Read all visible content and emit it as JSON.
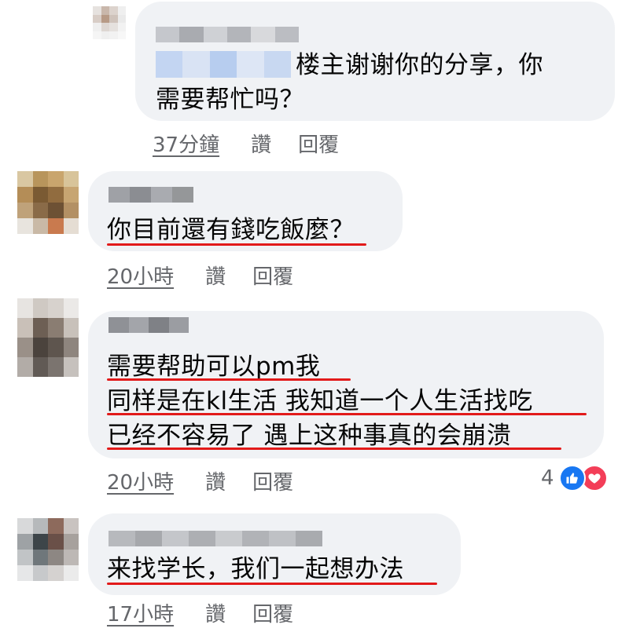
{
  "colors": {
    "bubble": "#f0f2f5",
    "meta_text": "#65676b",
    "underline": "#e21a1a",
    "like_blue": "#1877f2",
    "love_red": "#f33e58"
  },
  "comments": [
    {
      "text_lines": [
        "楼主谢谢你的分享，你",
        "需要帮忙吗？"
      ],
      "time": "37分鐘",
      "like": "讚",
      "reply": "回覆"
    },
    {
      "text_lines": [
        "你目前還有錢吃飯麼？"
      ],
      "time": "20小時",
      "like": "讚",
      "reply": "回覆"
    },
    {
      "text_lines": [
        "需要帮助可以pm我",
        "同样是在kl生活 我知道一个人生活找吃",
        "已经不容易了 遇上这种事真的会崩溃"
      ],
      "time": "20小時",
      "like": "讚",
      "reply": "回覆",
      "reaction_count": "4",
      "reaction_icons": [
        "like-icon",
        "love-icon"
      ]
    },
    {
      "text_lines": [
        "来找学长，我们一起想办法"
      ],
      "time": "17小時",
      "like": "讚",
      "reply": "回覆"
    }
  ]
}
